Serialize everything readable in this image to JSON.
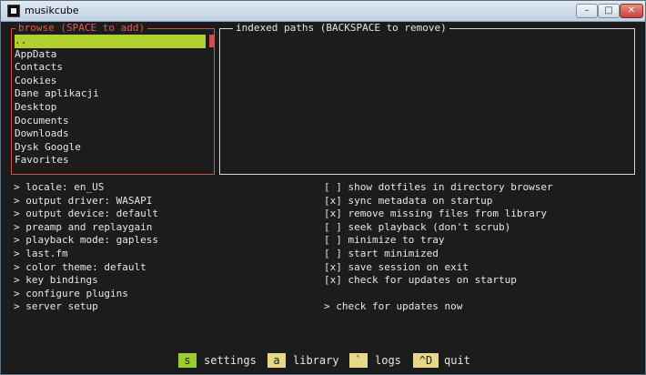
{
  "window": {
    "title": "musikcube",
    "min_label": "–",
    "max_label": "□",
    "close_label": "✕"
  },
  "browse": {
    "title": "browse (SPACE to add)",
    "items": [
      "..",
      "AppData",
      "Contacts",
      "Cookies",
      "Dane aplikacji",
      "Desktop",
      "Documents",
      "Downloads",
      "Dysk Google",
      "Favorites"
    ]
  },
  "indexed": {
    "title": "indexed paths (BACKSPACE to remove)"
  },
  "settings_left": [
    "> locale: en_US",
    "> output driver: WASAPI",
    "> output device: default",
    "> preamp and replaygain",
    "> playback mode: gapless",
    "> last.fm",
    "> color theme: default",
    "> key bindings",
    "> configure plugins",
    "> server setup"
  ],
  "settings_right": [
    "[ ] show dotfiles in directory browser",
    "[x] sync metadata on startup",
    "[x] remove missing files from library",
    "[ ] seek playback (don't scrub)",
    "[ ] minimize to tray",
    "[ ] start minimized",
    "[x] save session on exit",
    "[x] check for updates on startup"
  ],
  "check_updates": "> check for updates now",
  "footer": [
    {
      "key": "s",
      "label": "settings"
    },
    {
      "key": "a",
      "label": "library"
    },
    {
      "key": "`",
      "label": "logs"
    },
    {
      "key": "^D",
      "label": "quit"
    }
  ],
  "colors": {
    "accent_red": "#d05050",
    "selected_green": "#b0d030",
    "key_yellow": "#e8d88a",
    "key_active": "#9acd32",
    "background": "#1c1c1c"
  }
}
